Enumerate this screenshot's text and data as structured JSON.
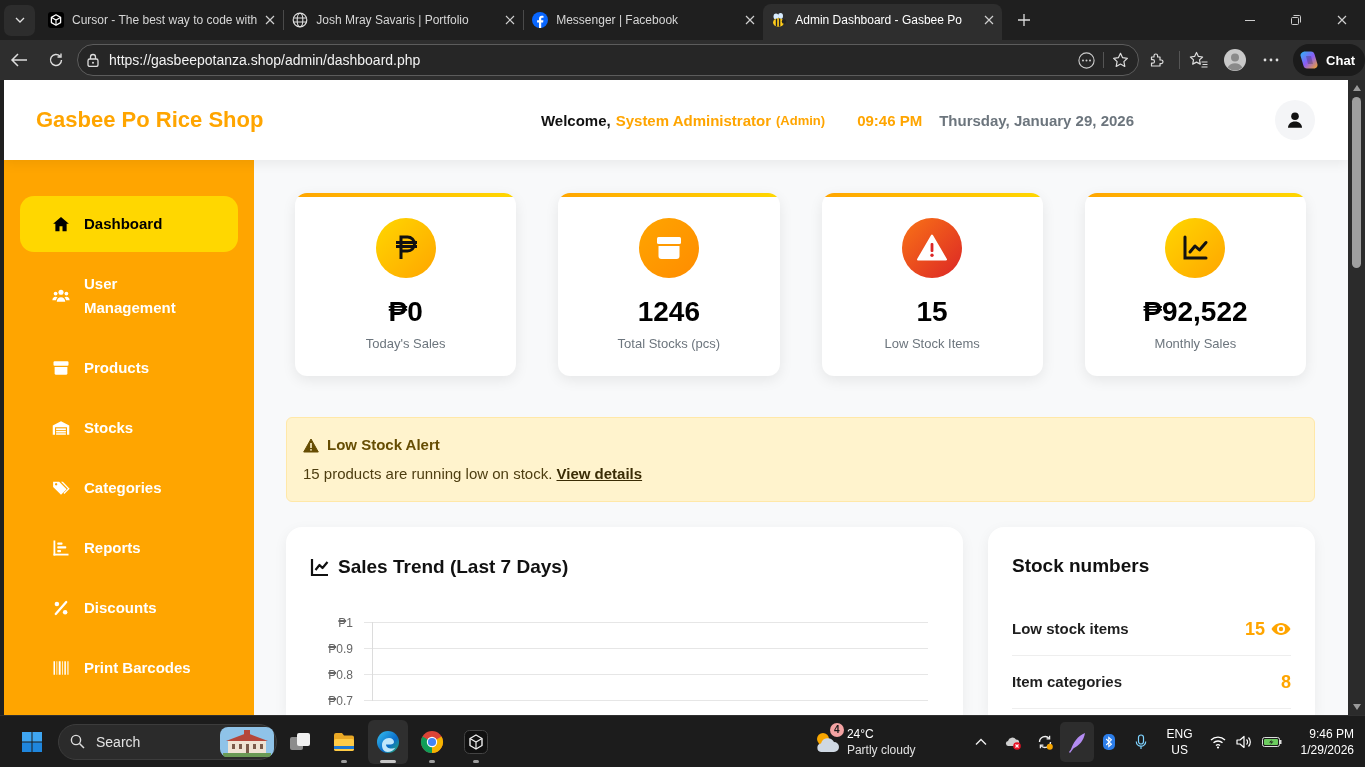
{
  "browser": {
    "tabs": [
      {
        "title": "Cursor - The best way to code with",
        "selected": false
      },
      {
        "title": "Josh Mray Savaris | Portfolio",
        "selected": false
      },
      {
        "title": "Messenger | Facebook",
        "selected": false
      },
      {
        "title": "Admin Dashboard - Gasbee Po",
        "selected": true
      }
    ],
    "url": "https://gasbeepotanza.shop/admin/dashboard.php",
    "chat_button": "Chat"
  },
  "header": {
    "logo": "Gasbee Po Rice Shop",
    "welcome": "Welcome,",
    "user_name": "System Administrator",
    "role": "(Admin)",
    "time": "09:46 PM",
    "date": "Thursday, January 29, 2026"
  },
  "sidebar": {
    "items": [
      {
        "label": "Dashboard",
        "selected": true
      },
      {
        "label": "User Management",
        "selected": false
      },
      {
        "label": "Products",
        "selected": false
      },
      {
        "label": "Stocks",
        "selected": false
      },
      {
        "label": "Categories",
        "selected": false
      },
      {
        "label": "Reports",
        "selected": false
      },
      {
        "label": "Discounts",
        "selected": false
      },
      {
        "label": "Print Barcodes",
        "selected": false
      }
    ]
  },
  "stats": [
    {
      "value": "₱0",
      "label": "Today's Sales"
    },
    {
      "value": "1246",
      "label": "Total Stocks (pcs)"
    },
    {
      "value": "15",
      "label": "Low Stock Items"
    },
    {
      "value": "₱92,522",
      "label": "Monthly Sales"
    }
  ],
  "alert": {
    "title": "Low Stock Alert",
    "message": "15 products are running low on stock.",
    "link": "View details"
  },
  "sales_chart": {
    "title": "Sales Trend (Last 7 Days)",
    "chart_data": {
      "type": "line",
      "categories": [
        null,
        null,
        null,
        null,
        null,
        null,
        null
      ],
      "ylim": [
        0.7,
        1
      ],
      "grid": true,
      "yticks": [
        {
          "value": 1,
          "label": "₱1"
        },
        {
          "value": 0.9,
          "label": "₱0.9"
        },
        {
          "value": 0.8,
          "label": "₱0.8"
        },
        {
          "value": 0.7,
          "label": "₱0.7"
        }
      ]
    }
  },
  "stock_numbers": {
    "title": "Stock numbers",
    "rows": [
      {
        "label": "Low stock items",
        "value": "15",
        "kind": "action"
      },
      {
        "label": "Item categories",
        "value": "8",
        "kind": "plain"
      }
    ]
  },
  "taskbar": {
    "search": {
      "placeholder": "Search"
    },
    "apps": [
      {
        "running": false,
        "selected": false
      },
      {
        "running": true,
        "selected": false
      },
      {
        "running": true,
        "selected": true
      },
      {
        "running": true,
        "selected": false
      },
      {
        "running": true,
        "selected": false
      }
    ],
    "weather": {
      "badge": "4",
      "temperature": "24°C",
      "condition": "Partly cloudy"
    },
    "language": "ENG",
    "region": "US",
    "time": "9:46 PM",
    "date": "1/29/2026"
  }
}
